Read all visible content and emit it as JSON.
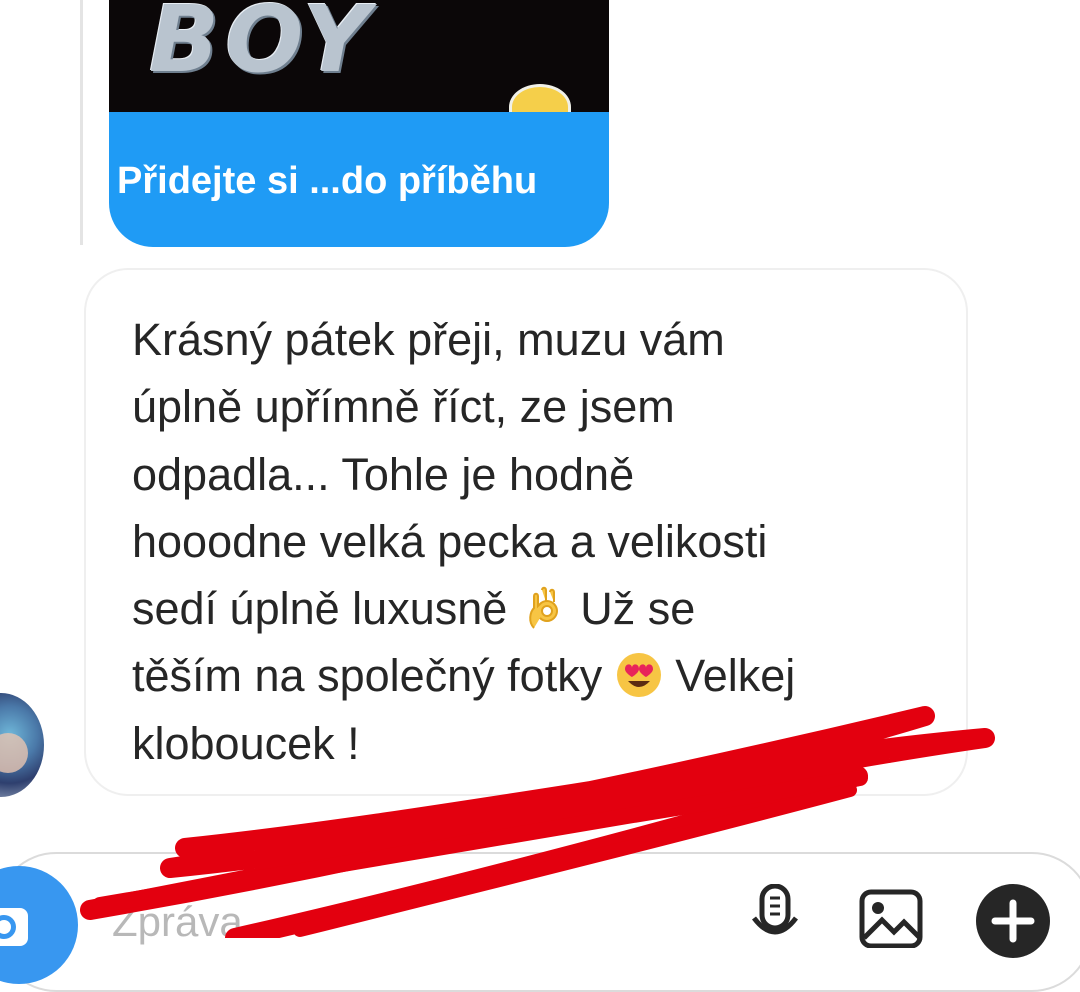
{
  "story_reply": {
    "image_text": "BOY",
    "caption": "Přidejte si ...do příběhu"
  },
  "message": {
    "text_part1": "Krásný pátek přeji, muzu vám\núplně upřímně říct, ze jsem\nodpadla... Tohle je hodně\nhooodne velká pecka a velikosti\nsedí úplně luxusně ",
    "text_part2": " Už se\ntěším na společný fotky ",
    "text_part3": " Velkej\nkloboucek !"
  },
  "composer": {
    "placeholder": "Zpráva"
  },
  "icons": {
    "camera": "camera-icon",
    "microphone": "microphone-icon",
    "gallery": "gallery-icon",
    "plus": "plus-icon",
    "ok_hand": "ok-hand-emoji",
    "heart_eyes": "heart-eyes-emoji"
  },
  "colors": {
    "story_caption_bg": "#1f9bf5",
    "camera_button": "#3897f0",
    "scribble": "#e3000f",
    "text": "#262626"
  }
}
